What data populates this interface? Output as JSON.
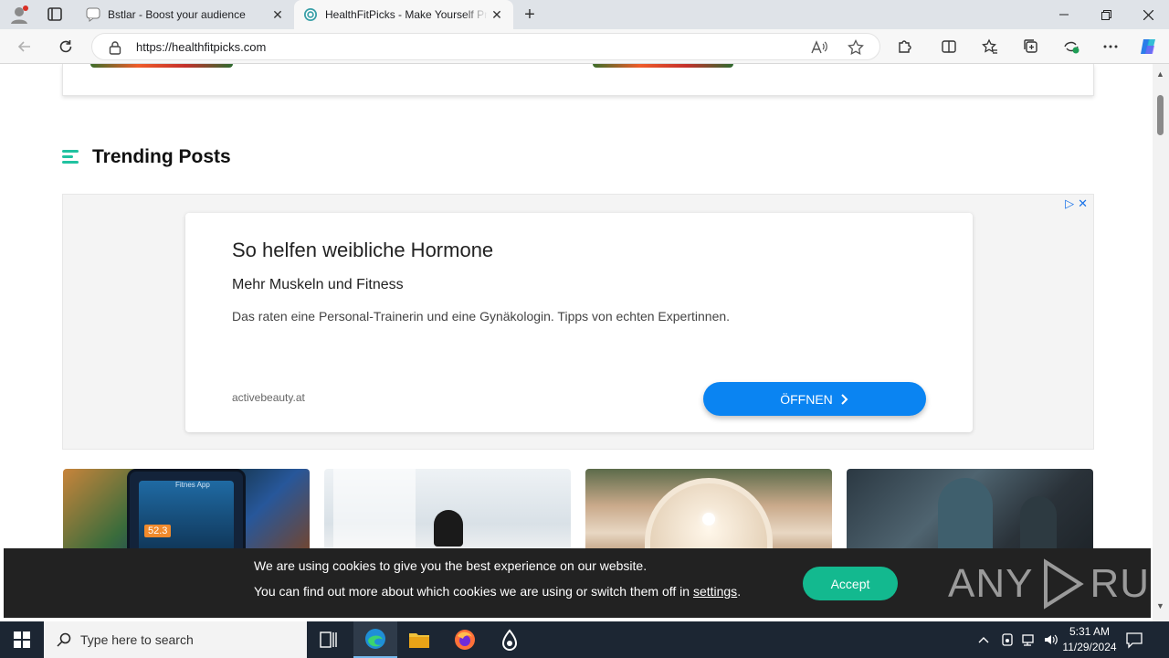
{
  "browser": {
    "tabs": [
      {
        "title": "Bstlar - Boost your audience",
        "icon": "chat-bubble-icon",
        "active": false
      },
      {
        "title": "HealthFitPicks - Make Yourself Pr",
        "icon": "globe-favicon",
        "active": true
      }
    ],
    "address": {
      "url": "https://healthfitpicks.com"
    }
  },
  "page": {
    "section_title": "Trending Posts",
    "ad": {
      "title": "So helfen weibliche Hormone",
      "subtitle": "Mehr Muskeln und Fitness",
      "description": "Das raten eine Personal-Trainerin und eine Gynäkologin. Tipps von echten Expertinnen.",
      "domain": "activebeauty.at",
      "cta": "ÖFFNEN"
    },
    "thumb1_number": "52.3",
    "thumb1_label": "Fitnes App"
  },
  "cookie": {
    "line1": "We are using cookies to give you the best experience on our website.",
    "line2_prefix": "You can find out more about which cookies we are using or switch them off in",
    "settings_link": "settings",
    "line2_suffix": ".",
    "accept": "Accept",
    "watermark_left": "ANY",
    "watermark_right": "RUN"
  },
  "taskbar": {
    "search_placeholder": "Type here to search",
    "time": "5:31 AM",
    "date": "11/29/2024"
  },
  "colors": {
    "accent_green": "#20c2a0",
    "cta_blue": "#0a84f2",
    "accept_green": "#13b98f"
  }
}
